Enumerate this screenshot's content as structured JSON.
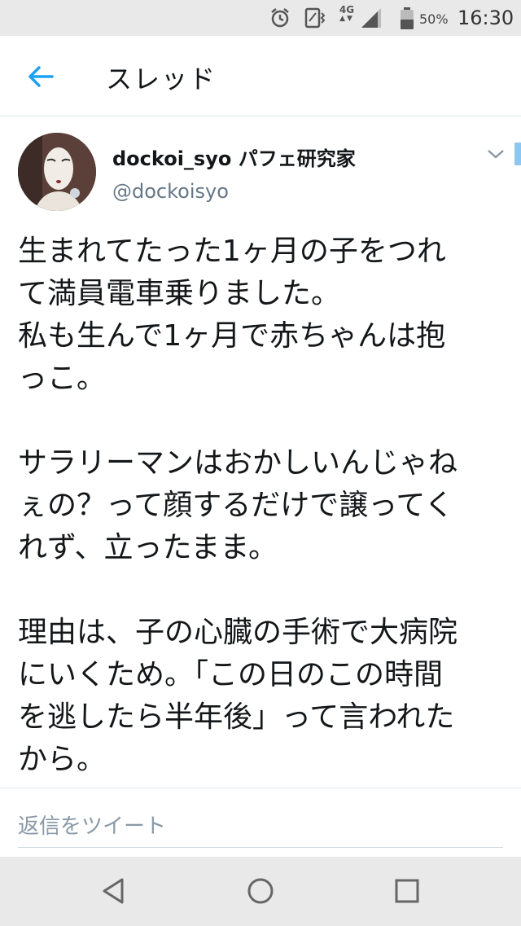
{
  "status_bar": {
    "network": "4G",
    "battery": "50%",
    "time": "16:30",
    "icons": [
      "alarm-icon",
      "vibrate-icon",
      "signal-icon",
      "battery-icon"
    ]
  },
  "header": {
    "title": "スレッド",
    "back_icon": "arrow-left-icon",
    "accent_color": "#1da1f2"
  },
  "tweet": {
    "display_name": "dockoi_syo パフェ研究家",
    "handle": "@dockoisyo",
    "avatar_icon": "noh-mask-avatar",
    "text": "生まれてたった1ヶ月の子をつれ\nて満員電車乗りました。\n私も生んで1ヶ月で赤ちゃんは抱\nっこ。\n\nサラリーマンはおかしいんじゃね\nぇの？って顔するだけで譲ってく\nれず、立ったまま。\n\n理由は、子の心臓の手術で大病院\nにいくため。「この日のこの時間\nを逃したら半年後」って言われた\nから。"
  },
  "reply": {
    "placeholder": "返信をツイート"
  },
  "navigation": {
    "buttons": [
      "back-triangle-icon",
      "home-circle-icon",
      "recents-square-icon"
    ]
  }
}
